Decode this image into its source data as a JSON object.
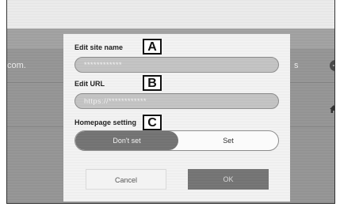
{
  "background": {
    "url_fragment": "com.",
    "side_fragment": "s",
    "add_icon": "plus-circle-icon",
    "home_icon": "home-icon"
  },
  "dialog": {
    "site_name": {
      "label": "Edit site name",
      "value": "************",
      "callout": "A"
    },
    "url": {
      "label": "Edit URL",
      "value": "https://************",
      "callout": "B"
    },
    "homepage": {
      "label": "Homepage setting",
      "callout": "C",
      "options": [
        "Don't set",
        "Set"
      ],
      "selected": "Don't set"
    },
    "cancel_label": "Cancel",
    "ok_label": "OK"
  }
}
